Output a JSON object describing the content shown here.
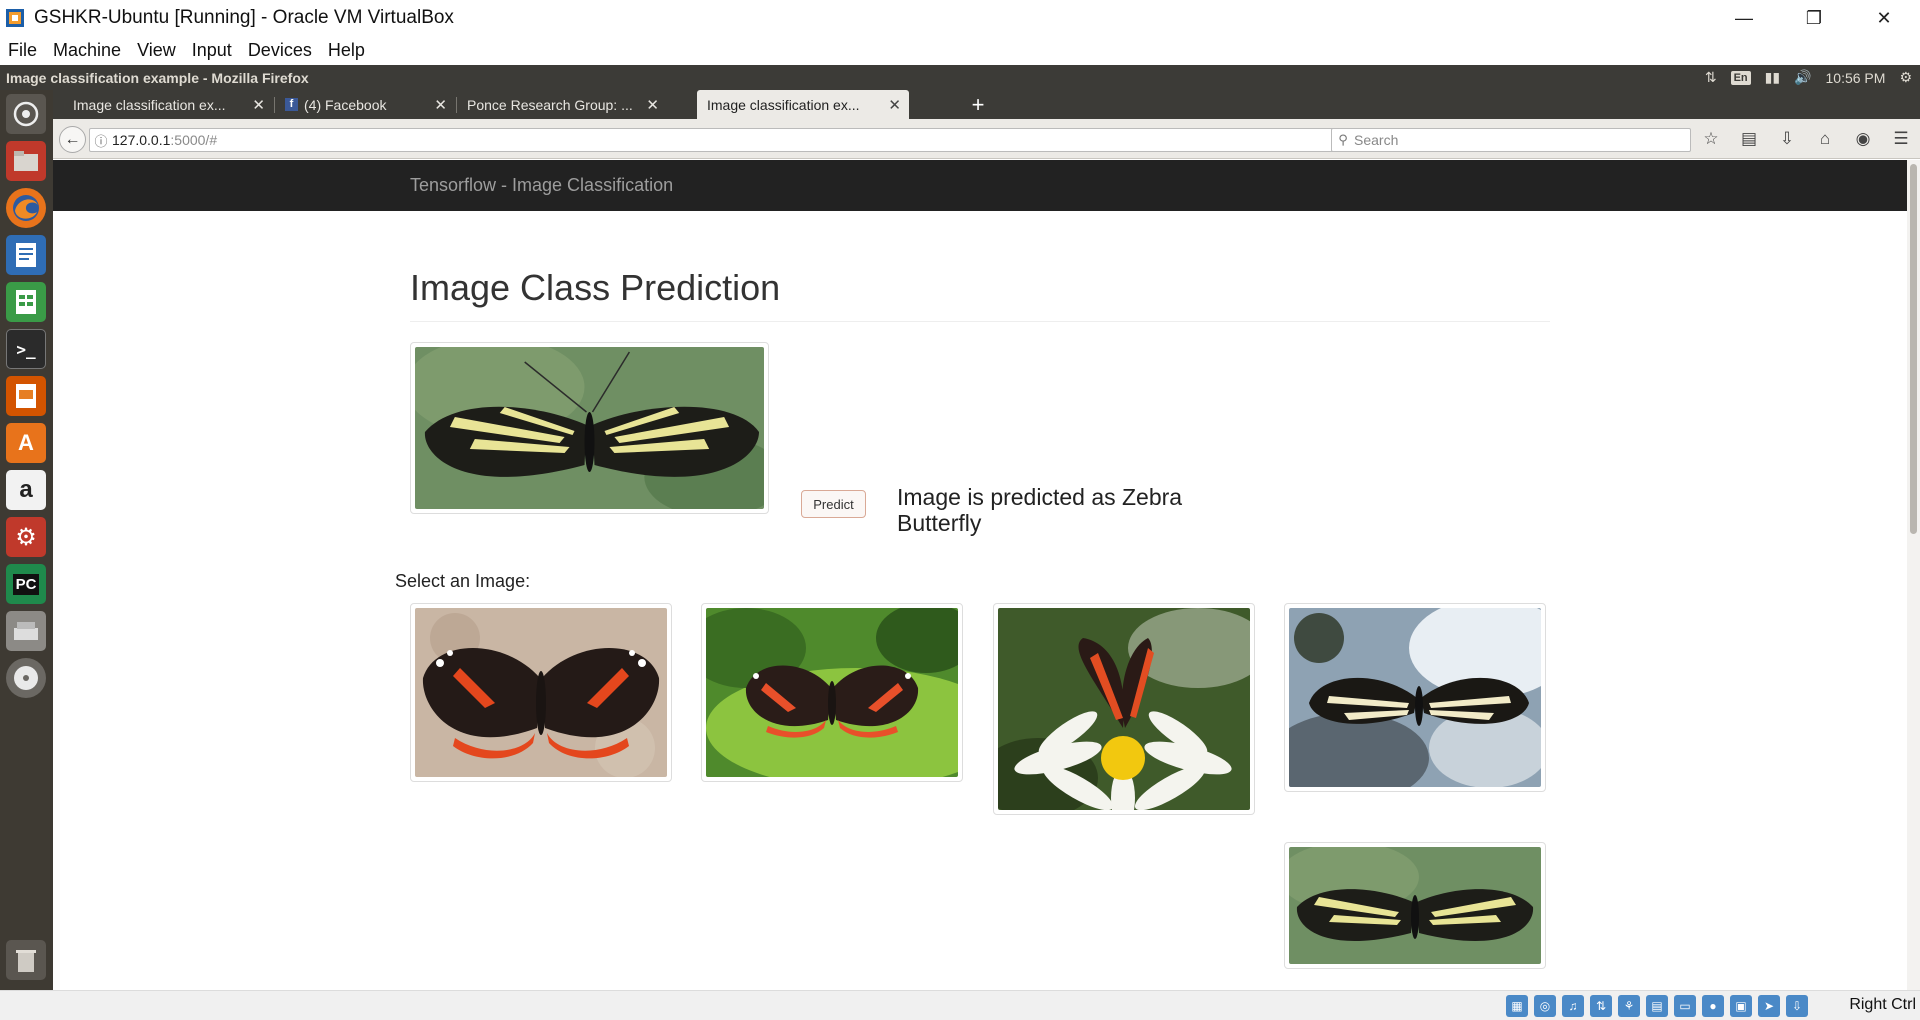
{
  "vbox": {
    "title": "GSHKR-Ubuntu [Running] - Oracle VM VirtualBox",
    "menu": [
      "File",
      "Machine",
      "View",
      "Input",
      "Devices",
      "Help"
    ],
    "host_key": "Right Ctrl"
  },
  "ubuntu": {
    "window_title": "Image classification example - Mozilla Firefox",
    "keyboard": "En",
    "clock": "10:56 PM"
  },
  "browser": {
    "tabs": [
      {
        "label": "Image classification ex...",
        "active": false
      },
      {
        "label": "(4) Facebook",
        "active": false
      },
      {
        "label": "Ponce Research Group: ...",
        "active": false
      },
      {
        "label": "Image classification ex...",
        "active": true
      }
    ],
    "url_host": "127.0.0.1",
    "url_rest": ":5000/#",
    "search_placeholder": "Search"
  },
  "page": {
    "brand": "Tensorflow - Image Classification",
    "title": "Image Class Prediction",
    "predict_label": "Predict",
    "prediction": "Image is predicted as Zebra Butterfly",
    "select_label": "Select an Image:",
    "selected_image": "zebra-butterfly",
    "gallery": [
      "red-admiral-sand",
      "red-admiral-leaf",
      "red-admiral-daisy",
      "zebra-butterfly-rock",
      "zebra-butterfly"
    ]
  }
}
